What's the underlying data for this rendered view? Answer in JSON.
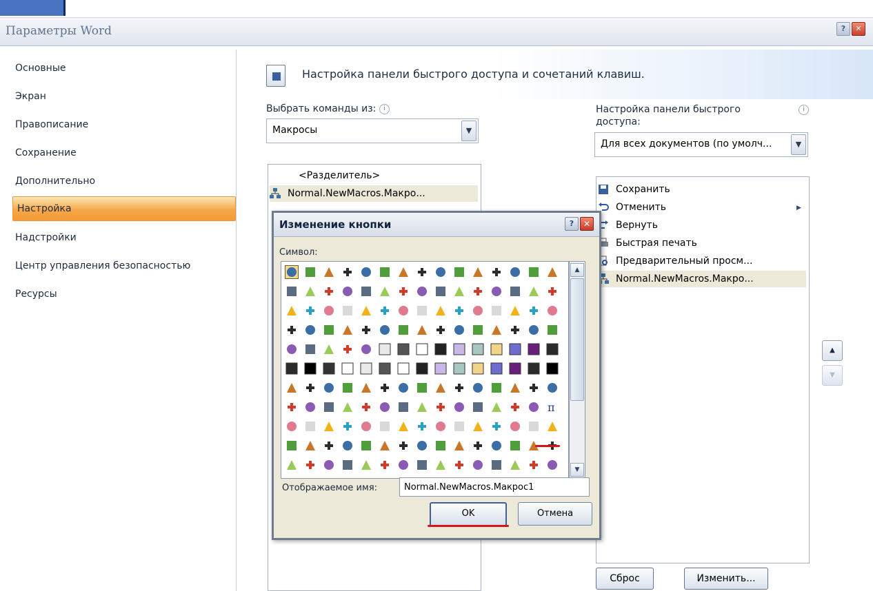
{
  "window": {
    "title": "Параметры Word"
  },
  "nav": {
    "items": [
      "Основные",
      "Экран",
      "Правописание",
      "Сохранение",
      "Дополнительно",
      "Настройка",
      "Надстройки",
      "Центр управления безопасностью",
      "Ресурсы"
    ],
    "selected": "Настройка"
  },
  "header": {
    "title": "Настройка панели быстрого доступа и сочетаний клавиш."
  },
  "choose": {
    "label": "Выбрать команды из:",
    "value": "Макросы"
  },
  "qat": {
    "label": "Настройка панели быстрого доступа:",
    "value": "Для всех документов (по умолч..."
  },
  "commands_list": [
    "<Разделитель>",
    "Normal.NewMacros.Макро..."
  ],
  "qat_list": [
    "Сохранить",
    "Отменить",
    "Вернуть",
    "Быстрая печать",
    "Предварительный просм...",
    "Normal.NewMacros.Макро..."
  ],
  "buttons": {
    "reset": "Сброс",
    "modify": "Изменить..."
  },
  "dialog": {
    "title": "Изменение кнопки",
    "symbol_label": "Символ:",
    "name_label": "Отображаемое имя:",
    "name_value": "Normal.NewMacros.Макрос1",
    "ok": "OK",
    "cancel": "Отмена"
  },
  "colors": {
    "accent_orange": "#f7a84a",
    "title_text": "#62738e",
    "highlight_red": "#d8141a"
  }
}
